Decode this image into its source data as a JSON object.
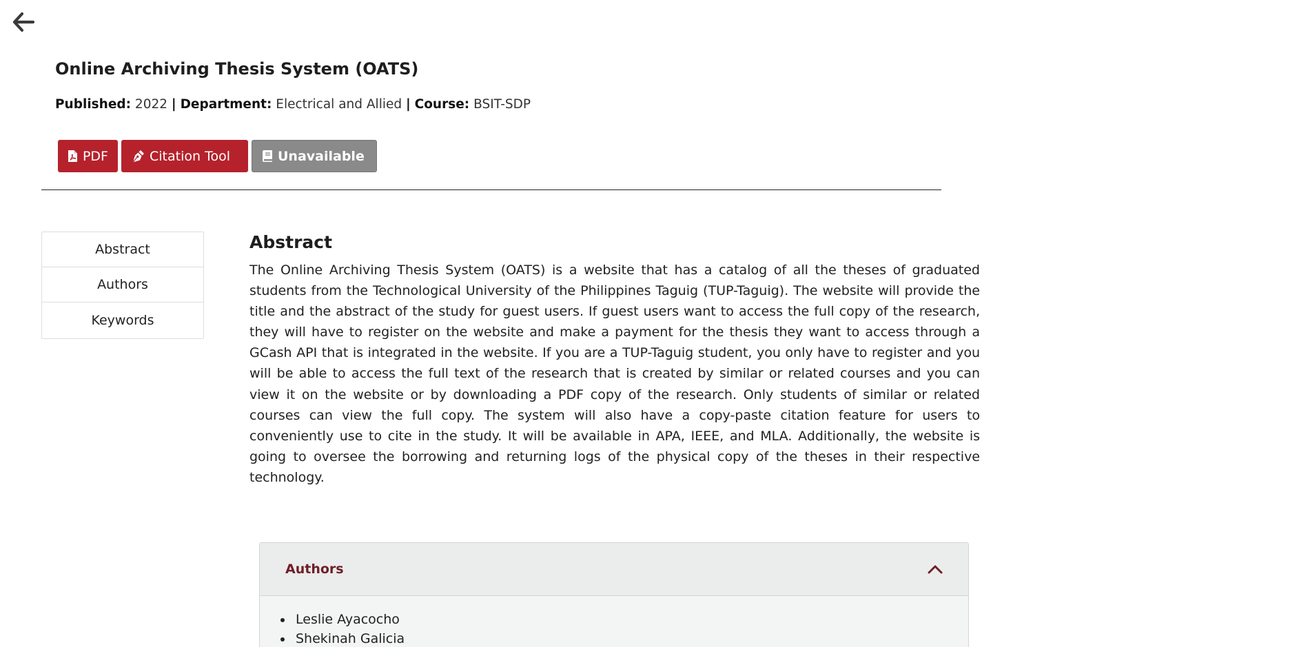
{
  "title": "Online Archiving Thesis System (OATS)",
  "meta": {
    "published_label": "Published:",
    "published_value": "2022",
    "department_label": "Department:",
    "department_value": "Electrical and Allied",
    "course_label": "Course:",
    "course_value": "BSIT-SDP",
    "separator": "|"
  },
  "actions": {
    "pdf_label": "PDF",
    "citation_label": "Citation Tool",
    "unavailable_label": "Unavailable"
  },
  "side_nav": [
    {
      "label": "Abstract"
    },
    {
      "label": "Authors"
    },
    {
      "label": "Keywords"
    }
  ],
  "abstract": {
    "heading": "Abstract",
    "text": "The Online Archiving Thesis System (OATS) is a website that has a catalog of all the theses of graduated students from the Technological University of the Philippines Taguig (TUP-Taguig). The website will provide the title and the abstract of the study for guest users. If guest users want to access the full copy of the research, they will have to register on the website and make a payment for the thesis they want to access through a GCash API that is integrated in the website. If you are a TUP-Taguig student, you only have to register and you will be able to access the full text of the research that is created by similar or related courses and you can view it on the website or by downloading a PDF copy of the research. Only students of similar or related courses can view the full copy. The system will also have a copy-paste citation feature for users to conveniently use to cite in the study. It will be available in APA, IEEE, and MLA. Additionally, the website is going to oversee the borrowing and returning logs of the physical copy of the theses in their respective technology."
  },
  "authors_panel": {
    "title": "Authors",
    "authors": [
      "Leslie Ayacocho",
      "Shekinah Galicia"
    ]
  },
  "icons": {
    "back": "arrow-left-icon",
    "pdf": "file-pdf-icon",
    "citation": "pen-nib-icon",
    "unavailable": "book-icon",
    "collapse": "chevron-up-icon"
  },
  "colors": {
    "accent_red": "#b5222c",
    "unavailable_gray": "#8a8a8a",
    "authors_title": "#6e1f27"
  }
}
